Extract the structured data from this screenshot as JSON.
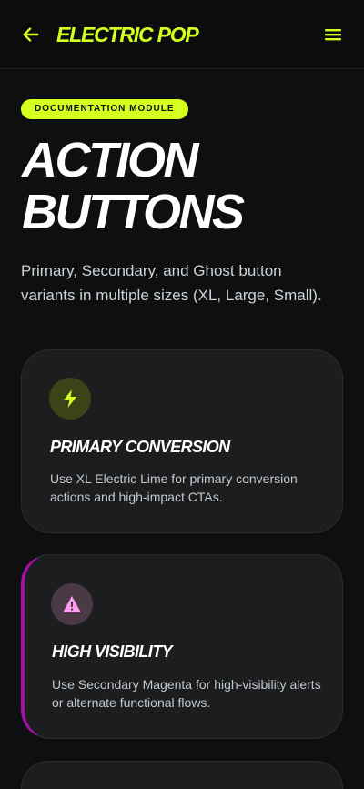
{
  "header": {
    "brand": "ELECTRIC POP",
    "back_icon": "arrow-left-icon",
    "menu_icon": "hamburger-menu-icon",
    "accent": "#d6ff1f"
  },
  "hero": {
    "badge": "DOCUMENTATION MODULE",
    "title_line1": "ACTION",
    "title_line2": "BUTTONS",
    "description": "Primary, Secondary, and Ghost button variants in multiple sizes (XL, Large, Small)."
  },
  "cards": [
    {
      "icon": "lightning-bolt-icon",
      "icon_color": "#d6ff1f",
      "title": "PRIMARY CONVERSION",
      "description": "Use XL Electric Lime for primary conversion actions and high-impact CTAs."
    },
    {
      "icon": "warning-triangle-icon",
      "icon_color": "#ff9cf0",
      "accent": "#a30fa8",
      "title": "HIGH VISIBILITY",
      "description": "Use Secondary Magenta for high-visibility alerts or alternate functional flows."
    }
  ]
}
